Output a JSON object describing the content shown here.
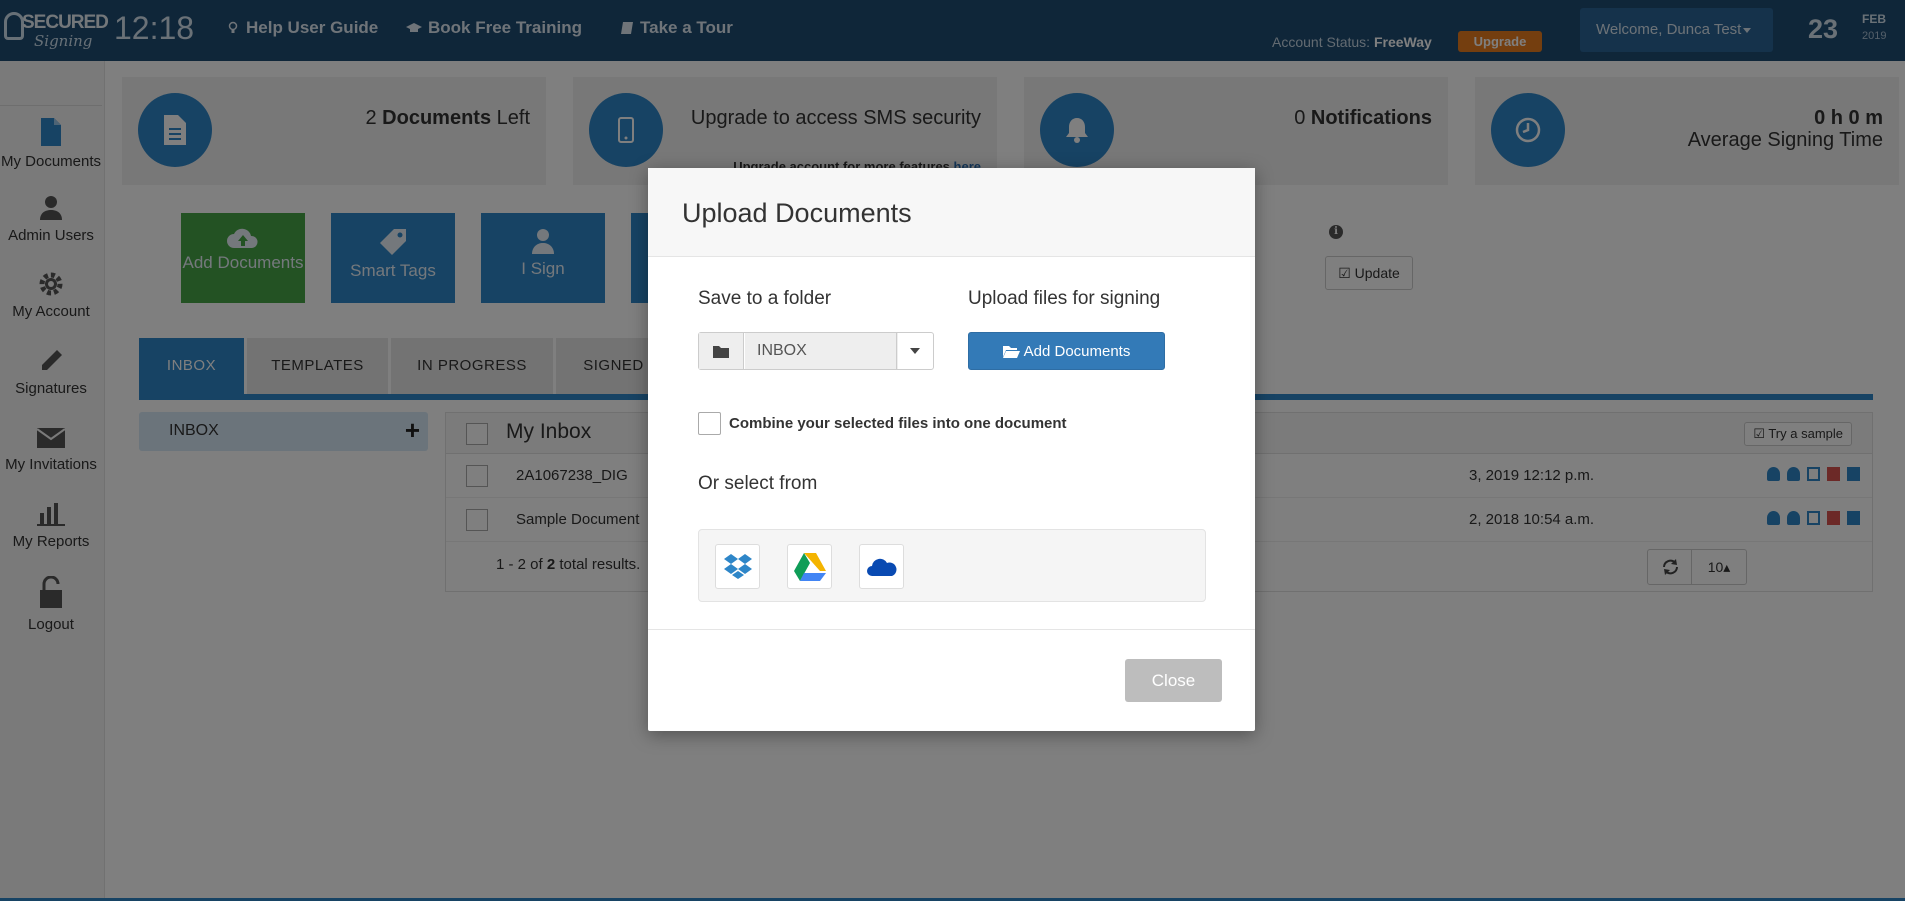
{
  "header": {
    "logo_top": "SECURED",
    "logo_bottom": "Signing",
    "clock": "12:18",
    "links": [
      "Help User Guide",
      "Book Free Training",
      "Take a Tour"
    ],
    "account_status_label": "Account Status:",
    "account_status_value": "FreeWay",
    "upgrade_label": "Upgrade",
    "welcome": "Welcome,  Dunca Test",
    "date_day": "23",
    "date_month": "FEB",
    "date_year": "2019"
  },
  "sidebar": {
    "items": [
      {
        "label": "My Documents",
        "icon": "document-icon"
      },
      {
        "label": "Admin Users",
        "icon": "user-icon"
      },
      {
        "label": "My Account",
        "icon": "gear-icon"
      },
      {
        "label": "Signatures",
        "icon": "pencil-icon"
      },
      {
        "label": "My Invitations",
        "icon": "envelope-icon"
      },
      {
        "label": "My Reports",
        "icon": "bar-chart-icon"
      },
      {
        "label": "Logout",
        "icon": "unlock-icon"
      }
    ]
  },
  "stats": {
    "documents_count": "2",
    "documents_label": "Documents",
    "documents_suffix": "Left",
    "sms_text": "Upgrade to access SMS security",
    "sms_sub": "Upgrade account for more features",
    "sms_link": "here",
    "notifications_count": "0",
    "notifications_label": "Notifications",
    "signing_time": "0 h 0 m",
    "signing_label": "Average Signing Time"
  },
  "actions": {
    "add_documents": "Add Documents",
    "smart_tags": "Smart Tags",
    "i_sign": "I Sign",
    "update": "Update"
  },
  "tabs": [
    "INBOX",
    "TEMPLATES",
    "IN PROGRESS",
    "SIGNED"
  ],
  "folders": {
    "current": "INBOX"
  },
  "inbox": {
    "title": "My Inbox",
    "try_sample": "Try a sample",
    "rows": [
      {
        "name": "2A1067238_DIG",
        "date": "3, 2019 12:12 p.m."
      },
      {
        "name": "Sample Document",
        "date": "2, 2018 10:54 a.m."
      }
    ],
    "results_prefix": "1 - 2 of",
    "results_total": "2",
    "results_suffix": "total results.",
    "page_size": "10"
  },
  "modal": {
    "title": "Upload Documents",
    "save_label": "Save to a folder",
    "upload_label": "Upload files for signing",
    "folder_value": "INBOX",
    "add_documents_button": "Add Documents",
    "combine_label": "Combine your selected files into one document",
    "select_from_label": "Or select from",
    "sources": [
      "dropbox-icon",
      "google-drive-icon",
      "onedrive-icon"
    ],
    "close_button": "Close"
  },
  "colors": {
    "topbar": "#1f4d73",
    "accent": "#2e86c8",
    "green": "#46a546",
    "upgrade": "#e97d1f",
    "primary_button": "#337ab7"
  }
}
